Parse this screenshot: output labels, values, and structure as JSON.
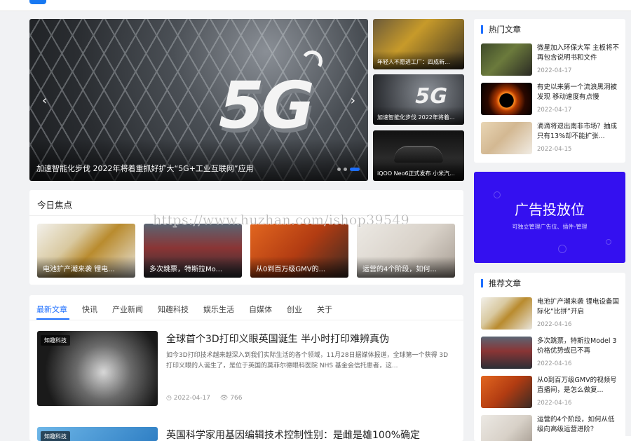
{
  "header": {
    "logo_text": ""
  },
  "hero": {
    "caption": "加速智能化步伐 2022年将着重抓好扩大“5G+工业互联网”应用",
    "image_text": "5G",
    "prev_icon": "chevron-left-icon",
    "next_icon": "chevron-right-icon",
    "slide_count": 3,
    "active_slide": 3
  },
  "side_slides": [
    {
      "caption": "年轻人不愿进工厂：四成新..."
    },
    {
      "caption": "加速智能化步伐 2022年将着..."
    },
    {
      "caption": "iQOO Neo6正式发布 小米汽..."
    }
  ],
  "focus": {
    "title": "今日焦点",
    "items": [
      {
        "caption": "电池扩产潮来袭 锂电..."
      },
      {
        "caption": "多次跳票，特斯拉Mo..."
      },
      {
        "caption": "从0到百万级GMV的..."
      },
      {
        "caption": "运营的4个阶段，如何..."
      }
    ]
  },
  "feed": {
    "tabs": [
      "最新文章",
      "快讯",
      "产业新闻",
      "知趣科技",
      "娱乐生活",
      "自媒体",
      "创业",
      "关于"
    ],
    "articles": [
      {
        "tag": "知趣科技",
        "title": "全球首个3D打印义眼英国诞生 半小时打印难辨真伪",
        "desc": "如今3D打印技术越来越深入到我们实际生活的各个领域，11月28日据媒体报道，全球第一个获得 3D 打印义眼的人诞生了，是位于英国的莫菲尔德眼科医院 NHS 基金会信托患者，这...",
        "date": "2022-04-17",
        "views": "766"
      },
      {
        "tag": "知趣科技",
        "title": "英国科学家用基因编辑技术控制性别：是雌是雄100%确定"
      }
    ]
  },
  "hot": {
    "title": "热门文章",
    "items": [
      {
        "title": "微星加入环保大军 主板将不再包含说明书和文件",
        "date": "2022-04-17"
      },
      {
        "title": "有史以来第一个流浪黑洞被发现 移动速度有点慢",
        "date": "2022-04-17"
      },
      {
        "title": "滴滴将退出南非市场？抽成只有13%却不能扩张...",
        "date": "2022-04-15"
      }
    ]
  },
  "ad": {
    "title": "广告投放位",
    "subtitle": "可独立管理广告位、插件-管理"
  },
  "recommend": {
    "title": "推荐文章",
    "items": [
      {
        "title": "电池扩产潮来袭 锂电设备国际化“比拼”开启",
        "date": "2022-04-16"
      },
      {
        "title": "多次跳票，特斯拉Model 3价格优势或已不再",
        "date": "2022-04-16"
      },
      {
        "title": "从0到百万级GMV的视频号直播间，是怎么做复...",
        "date": "2022-04-16"
      },
      {
        "title": "运营的4个阶段，如何从低级向高级运营进阶？",
        "date": ""
      }
    ]
  },
  "watermark": "https://www.huzhan.com/ishop39549",
  "colors": {
    "accent": "#1e6fff",
    "ad_bg": "#3410f0"
  }
}
